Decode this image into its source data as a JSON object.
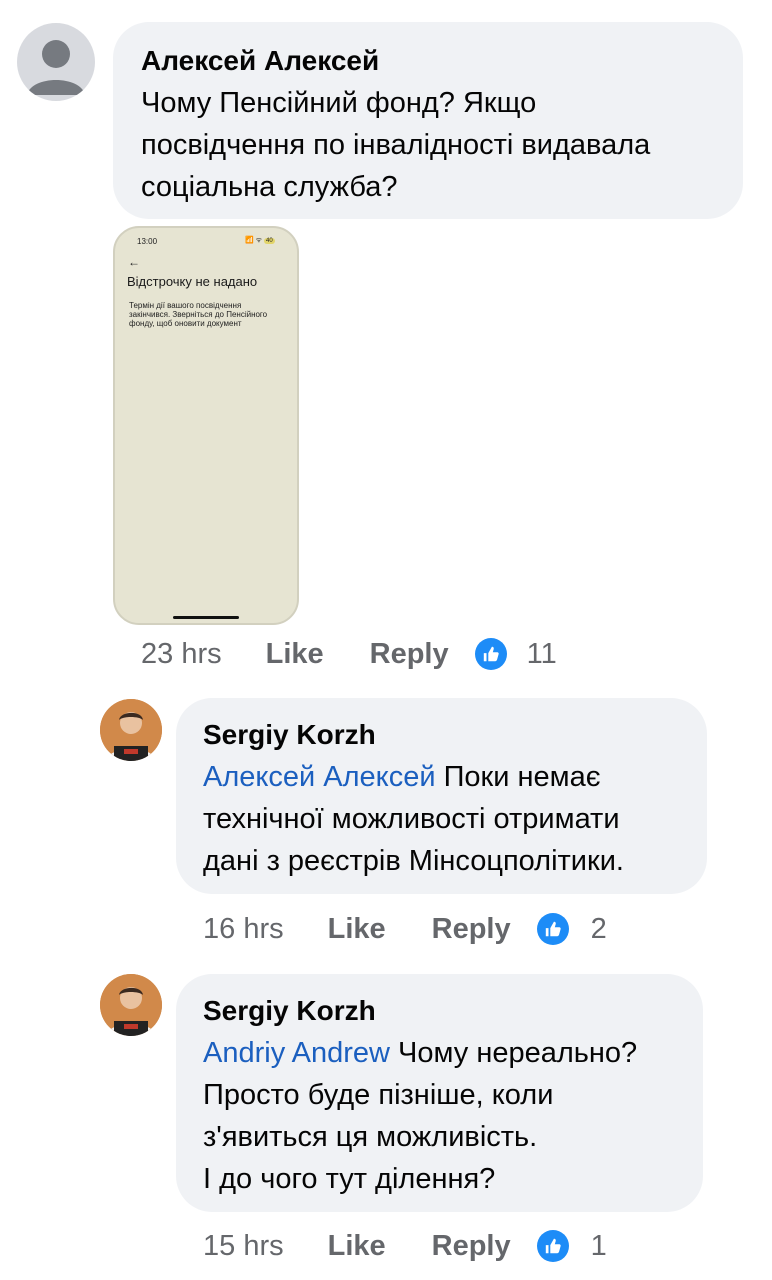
{
  "comments": [
    {
      "author": "Алексей Алексей",
      "text": "Чому Пенсійний фонд? Якщо\nпосвідчення по інвалідності видавала\nсоціальна служба?",
      "time": "23 hrs",
      "like_label": "Like",
      "reply_label": "Reply",
      "reactions": "11",
      "attachment": {
        "status_time": "13:00",
        "status_icons": "📶 ᯤ",
        "battery": "40",
        "back_arrow": "←",
        "title": "Відстрочку не надано",
        "message": "Термін дії вашого посвідчення закінчився. Зверніться до Пенсійного фонду, щоб оновити документ"
      }
    },
    {
      "author": "Sergiy Korzh",
      "mention": "Алексей Алексей",
      "text_first": " Поки немає",
      "text_rest": "технічної можливості отримати\nдані з реєстрів Мінсоцполітики.",
      "time": "16 hrs",
      "like_label": "Like",
      "reply_label": "Reply",
      "reactions": "2"
    },
    {
      "author": "Sergiy Korzh",
      "mention": "Andriy Andrew",
      "text_first": " Чому нереально?",
      "text_rest": "Просто буде пізніше, коли\nз'явиться ця можливість.\nІ до чого тут ділення?",
      "time": "15 hrs",
      "like_label": "Like",
      "reply_label": "Reply",
      "reactions": "1"
    }
  ],
  "icons": {
    "like_reaction": "thumbs-up-icon",
    "avatar_default": "default-user-icon"
  },
  "colors": {
    "bubble": "#f0f2f5",
    "mention": "#1b5fbf",
    "like_blue": "#1d8cf7",
    "meta_gray": "#65676b"
  }
}
